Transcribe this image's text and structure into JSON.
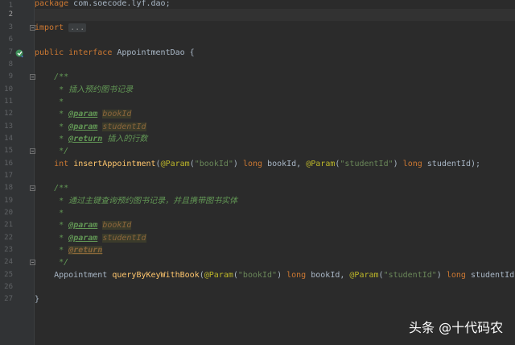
{
  "line_numbers": [
    "1",
    "2",
    "3",
    "6",
    "7",
    "8",
    "9",
    "10",
    "11",
    "12",
    "13",
    "14",
    "15",
    "16",
    "17",
    "18",
    "19",
    "20",
    "21",
    "22",
    "23",
    "24",
    "25",
    "26",
    "27"
  ],
  "code": {
    "package_kw": "package",
    "package_name": " com.soecode.lyf.dao;",
    "import_kw": "import",
    "import_collapsed": "...",
    "public_kw": "public",
    "interface_kw": "interface",
    "interface_name": " AppointmentDao {",
    "doc_open": "/**",
    "doc_star": "*",
    "doc_close": "*/",
    "m1_desc": "* 插入预约图书记录",
    "tag_param": "@param",
    "tag_return": "@return",
    "p_bookId": "bookId",
    "p_studentId": "studentId",
    "m1_return_desc": " 插入的行数",
    "int_kw": "int",
    "m1_name": "insertAppointment",
    "annot_param": "@Param",
    "str_bookId": "\"bookId\"",
    "str_studentId": "\"studentId\"",
    "long_kw": "long",
    "arg_bookId": " bookId, ",
    "arg_studentId": " studentId);",
    "m2_desc": "* 通过主键查询预约图书记录，并且携带图书实体",
    "m2_type": "Appointment ",
    "m2_name": "queryByKeyWithBook",
    "close_brace": "}"
  },
  "watermark": "头条 @十代码农"
}
